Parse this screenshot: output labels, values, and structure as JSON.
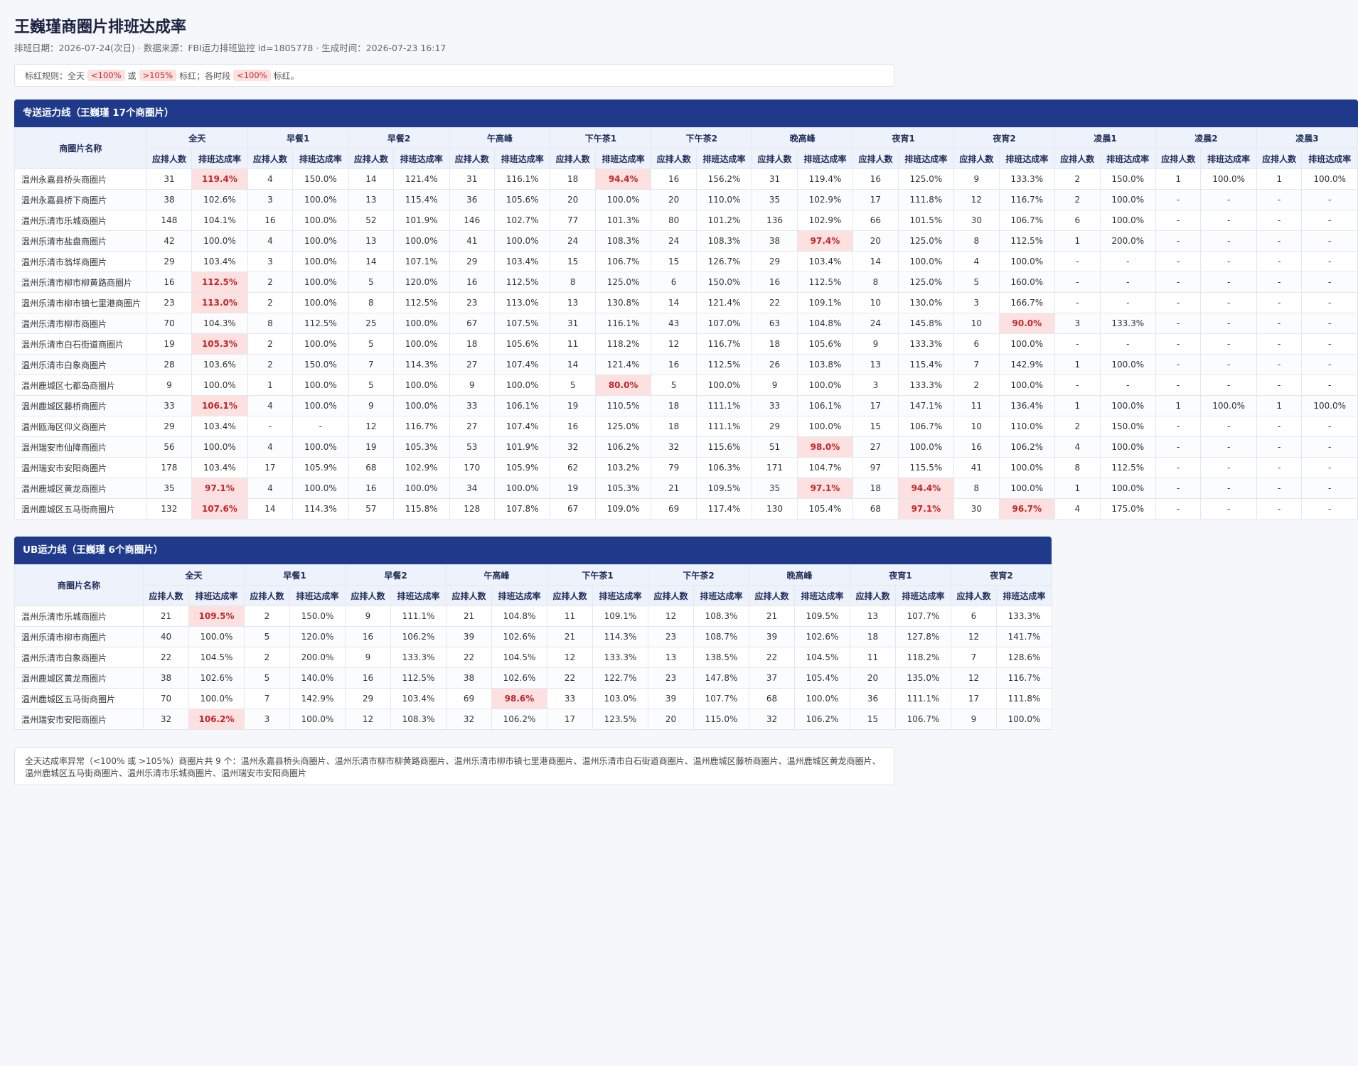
{
  "title": "王巍瑾商圈片排班达成率",
  "subtitle": "排班日期：2026-07-24(次日) · 数据来源：FBI运力排班监控 id=1805778 · 生成时间：2026-07-23 16:17",
  "rules": {
    "prefix": "标红规则：全天",
    "chip1": "<100%",
    "or": "或",
    "chip2": ">105%",
    "mid": "标红；各时段",
    "chip3": "<100%",
    "suffix": "标红。"
  },
  "colors": {
    "header_bar": "#1f3a8a",
    "alert_bg": "#fde1e1",
    "alert_text": "#c0262b"
  },
  "table1": {
    "title": "专送运力线（王巍瑾 17个商圈片）",
    "name_header": "商圈片名称",
    "sub_headers": [
      "应排人数",
      "排班达成率"
    ],
    "periods": [
      "全天",
      "早餐1",
      "早餐2",
      "午高峰",
      "下午茶1",
      "下午茶2",
      "晚高峰",
      "夜宵1",
      "夜宵2",
      "凌晨1",
      "凌晨2",
      "凌晨3"
    ],
    "rows": [
      {
        "name": "温州永嘉县桥头商圈片",
        "cells": [
          [
            "31",
            "119.4%"
          ],
          [
            "4",
            "150.0%"
          ],
          [
            "14",
            "121.4%"
          ],
          [
            "31",
            "116.1%"
          ],
          [
            "18",
            "94.4%"
          ],
          [
            "16",
            "156.2%"
          ],
          [
            "31",
            "119.4%"
          ],
          [
            "16",
            "125.0%"
          ],
          [
            "9",
            "133.3%"
          ],
          [
            "2",
            "150.0%"
          ],
          [
            "1",
            "100.0%"
          ],
          [
            "1",
            "100.0%"
          ]
        ]
      },
      {
        "name": "温州永嘉县桥下商圈片",
        "cells": [
          [
            "38",
            "102.6%"
          ],
          [
            "3",
            "100.0%"
          ],
          [
            "13",
            "115.4%"
          ],
          [
            "36",
            "105.6%"
          ],
          [
            "20",
            "100.0%"
          ],
          [
            "20",
            "110.0%"
          ],
          [
            "35",
            "102.9%"
          ],
          [
            "17",
            "111.8%"
          ],
          [
            "12",
            "116.7%"
          ],
          [
            "2",
            "100.0%"
          ],
          [
            "-",
            "-"
          ],
          [
            "-",
            "-"
          ]
        ]
      },
      {
        "name": "温州乐清市乐城商圈片",
        "cells": [
          [
            "148",
            "104.1%"
          ],
          [
            "16",
            "100.0%"
          ],
          [
            "52",
            "101.9%"
          ],
          [
            "146",
            "102.7%"
          ],
          [
            "77",
            "101.3%"
          ],
          [
            "80",
            "101.2%"
          ],
          [
            "136",
            "102.9%"
          ],
          [
            "66",
            "101.5%"
          ],
          [
            "30",
            "106.7%"
          ],
          [
            "6",
            "100.0%"
          ],
          [
            "-",
            "-"
          ],
          [
            "-",
            "-"
          ]
        ]
      },
      {
        "name": "温州乐清市盐盘商圈片",
        "cells": [
          [
            "42",
            "100.0%"
          ],
          [
            "4",
            "100.0%"
          ],
          [
            "13",
            "100.0%"
          ],
          [
            "41",
            "100.0%"
          ],
          [
            "24",
            "108.3%"
          ],
          [
            "24",
            "108.3%"
          ],
          [
            "38",
            "97.4%"
          ],
          [
            "20",
            "125.0%"
          ],
          [
            "8",
            "112.5%"
          ],
          [
            "1",
            "200.0%"
          ],
          [
            "-",
            "-"
          ],
          [
            "-",
            "-"
          ]
        ]
      },
      {
        "name": "温州乐清市翁垟商圈片",
        "cells": [
          [
            "29",
            "103.4%"
          ],
          [
            "3",
            "100.0%"
          ],
          [
            "14",
            "107.1%"
          ],
          [
            "29",
            "103.4%"
          ],
          [
            "15",
            "106.7%"
          ],
          [
            "15",
            "126.7%"
          ],
          [
            "29",
            "103.4%"
          ],
          [
            "14",
            "100.0%"
          ],
          [
            "4",
            "100.0%"
          ],
          [
            "-",
            "-"
          ],
          [
            "-",
            "-"
          ],
          [
            "-",
            "-"
          ]
        ]
      },
      {
        "name": "温州乐清市柳市柳黄路商圈片",
        "cells": [
          [
            "16",
            "112.5%"
          ],
          [
            "2",
            "100.0%"
          ],
          [
            "5",
            "120.0%"
          ],
          [
            "16",
            "112.5%"
          ],
          [
            "8",
            "125.0%"
          ],
          [
            "6",
            "150.0%"
          ],
          [
            "16",
            "112.5%"
          ],
          [
            "8",
            "125.0%"
          ],
          [
            "5",
            "160.0%"
          ],
          [
            "-",
            "-"
          ],
          [
            "-",
            "-"
          ],
          [
            "-",
            "-"
          ]
        ]
      },
      {
        "name": "温州乐清市柳市镇七里港商圈片",
        "cells": [
          [
            "23",
            "113.0%"
          ],
          [
            "2",
            "100.0%"
          ],
          [
            "8",
            "112.5%"
          ],
          [
            "23",
            "113.0%"
          ],
          [
            "13",
            "130.8%"
          ],
          [
            "14",
            "121.4%"
          ],
          [
            "22",
            "109.1%"
          ],
          [
            "10",
            "130.0%"
          ],
          [
            "3",
            "166.7%"
          ],
          [
            "-",
            "-"
          ],
          [
            "-",
            "-"
          ],
          [
            "-",
            "-"
          ]
        ]
      },
      {
        "name": "温州乐清市柳市商圈片",
        "cells": [
          [
            "70",
            "104.3%"
          ],
          [
            "8",
            "112.5%"
          ],
          [
            "25",
            "100.0%"
          ],
          [
            "67",
            "107.5%"
          ],
          [
            "31",
            "116.1%"
          ],
          [
            "43",
            "107.0%"
          ],
          [
            "63",
            "104.8%"
          ],
          [
            "24",
            "145.8%"
          ],
          [
            "10",
            "90.0%"
          ],
          [
            "3",
            "133.3%"
          ],
          [
            "-",
            "-"
          ],
          [
            "-",
            "-"
          ]
        ]
      },
      {
        "name": "温州乐清市白石街道商圈片",
        "cells": [
          [
            "19",
            "105.3%"
          ],
          [
            "2",
            "100.0%"
          ],
          [
            "5",
            "100.0%"
          ],
          [
            "18",
            "105.6%"
          ],
          [
            "11",
            "118.2%"
          ],
          [
            "12",
            "116.7%"
          ],
          [
            "18",
            "105.6%"
          ],
          [
            "9",
            "133.3%"
          ],
          [
            "6",
            "100.0%"
          ],
          [
            "-",
            "-"
          ],
          [
            "-",
            "-"
          ],
          [
            "-",
            "-"
          ]
        ]
      },
      {
        "name": "温州乐清市白象商圈片",
        "cells": [
          [
            "28",
            "103.6%"
          ],
          [
            "2",
            "150.0%"
          ],
          [
            "7",
            "114.3%"
          ],
          [
            "27",
            "107.4%"
          ],
          [
            "14",
            "121.4%"
          ],
          [
            "16",
            "112.5%"
          ],
          [
            "26",
            "103.8%"
          ],
          [
            "13",
            "115.4%"
          ],
          [
            "7",
            "142.9%"
          ],
          [
            "1",
            "100.0%"
          ],
          [
            "-",
            "-"
          ],
          [
            "-",
            "-"
          ]
        ]
      },
      {
        "name": "温州鹿城区七都岛商圈片",
        "cells": [
          [
            "9",
            "100.0%"
          ],
          [
            "1",
            "100.0%"
          ],
          [
            "5",
            "100.0%"
          ],
          [
            "9",
            "100.0%"
          ],
          [
            "5",
            "80.0%"
          ],
          [
            "5",
            "100.0%"
          ],
          [
            "9",
            "100.0%"
          ],
          [
            "3",
            "133.3%"
          ],
          [
            "2",
            "100.0%"
          ],
          [
            "-",
            "-"
          ],
          [
            "-",
            "-"
          ],
          [
            "-",
            "-"
          ]
        ]
      },
      {
        "name": "温州鹿城区藤桥商圈片",
        "cells": [
          [
            "33",
            "106.1%"
          ],
          [
            "4",
            "100.0%"
          ],
          [
            "9",
            "100.0%"
          ],
          [
            "33",
            "106.1%"
          ],
          [
            "19",
            "110.5%"
          ],
          [
            "18",
            "111.1%"
          ],
          [
            "33",
            "106.1%"
          ],
          [
            "17",
            "147.1%"
          ],
          [
            "11",
            "136.4%"
          ],
          [
            "1",
            "100.0%"
          ],
          [
            "1",
            "100.0%"
          ],
          [
            "1",
            "100.0%"
          ]
        ]
      },
      {
        "name": "温州瓯海区仰义商圈片",
        "cells": [
          [
            "29",
            "103.4%"
          ],
          [
            "-",
            "-"
          ],
          [
            "12",
            "116.7%"
          ],
          [
            "27",
            "107.4%"
          ],
          [
            "16",
            "125.0%"
          ],
          [
            "18",
            "111.1%"
          ],
          [
            "29",
            "100.0%"
          ],
          [
            "15",
            "106.7%"
          ],
          [
            "10",
            "110.0%"
          ],
          [
            "2",
            "150.0%"
          ],
          [
            "-",
            "-"
          ],
          [
            "-",
            "-"
          ]
        ]
      },
      {
        "name": "温州瑞安市仙降商圈片",
        "cells": [
          [
            "56",
            "100.0%"
          ],
          [
            "4",
            "100.0%"
          ],
          [
            "19",
            "105.3%"
          ],
          [
            "53",
            "101.9%"
          ],
          [
            "32",
            "106.2%"
          ],
          [
            "32",
            "115.6%"
          ],
          [
            "51",
            "98.0%"
          ],
          [
            "27",
            "100.0%"
          ],
          [
            "16",
            "106.2%"
          ],
          [
            "4",
            "100.0%"
          ],
          [
            "-",
            "-"
          ],
          [
            "-",
            "-"
          ]
        ]
      },
      {
        "name": "温州瑞安市安阳商圈片",
        "cells": [
          [
            "178",
            "103.4%"
          ],
          [
            "17",
            "105.9%"
          ],
          [
            "68",
            "102.9%"
          ],
          [
            "170",
            "105.9%"
          ],
          [
            "62",
            "103.2%"
          ],
          [
            "79",
            "106.3%"
          ],
          [
            "171",
            "104.7%"
          ],
          [
            "97",
            "115.5%"
          ],
          [
            "41",
            "100.0%"
          ],
          [
            "8",
            "112.5%"
          ],
          [
            "-",
            "-"
          ],
          [
            "-",
            "-"
          ]
        ]
      },
      {
        "name": "温州鹿城区黄龙商圈片",
        "cells": [
          [
            "35",
            "97.1%"
          ],
          [
            "4",
            "100.0%"
          ],
          [
            "16",
            "100.0%"
          ],
          [
            "34",
            "100.0%"
          ],
          [
            "19",
            "105.3%"
          ],
          [
            "21",
            "109.5%"
          ],
          [
            "35",
            "97.1%"
          ],
          [
            "18",
            "94.4%"
          ],
          [
            "8",
            "100.0%"
          ],
          [
            "1",
            "100.0%"
          ],
          [
            "-",
            "-"
          ],
          [
            "-",
            "-"
          ]
        ]
      },
      {
        "name": "温州鹿城区五马街商圈片",
        "cells": [
          [
            "132",
            "107.6%"
          ],
          [
            "14",
            "114.3%"
          ],
          [
            "57",
            "115.8%"
          ],
          [
            "128",
            "107.8%"
          ],
          [
            "67",
            "109.0%"
          ],
          [
            "69",
            "117.4%"
          ],
          [
            "130",
            "105.4%"
          ],
          [
            "68",
            "97.1%"
          ],
          [
            "30",
            "96.7%"
          ],
          [
            "4",
            "175.0%"
          ],
          [
            "-",
            "-"
          ],
          [
            "-",
            "-"
          ]
        ]
      }
    ]
  },
  "table2": {
    "title": "UB运力线（王巍瑾 6个商圈片）",
    "name_header": "商圈片名称",
    "sub_headers": [
      "应排人数",
      "排班达成率"
    ],
    "periods": [
      "全天",
      "早餐1",
      "早餐2",
      "午高峰",
      "下午茶1",
      "下午茶2",
      "晚高峰",
      "夜宵1",
      "夜宵2"
    ],
    "rows": [
      {
        "name": "温州乐清市乐城商圈片",
        "cells": [
          [
            "21",
            "109.5%"
          ],
          [
            "2",
            "150.0%"
          ],
          [
            "9",
            "111.1%"
          ],
          [
            "21",
            "104.8%"
          ],
          [
            "11",
            "109.1%"
          ],
          [
            "12",
            "108.3%"
          ],
          [
            "21",
            "109.5%"
          ],
          [
            "13",
            "107.7%"
          ],
          [
            "6",
            "133.3%"
          ]
        ]
      },
      {
        "name": "温州乐清市柳市商圈片",
        "cells": [
          [
            "40",
            "100.0%"
          ],
          [
            "5",
            "120.0%"
          ],
          [
            "16",
            "106.2%"
          ],
          [
            "39",
            "102.6%"
          ],
          [
            "21",
            "114.3%"
          ],
          [
            "23",
            "108.7%"
          ],
          [
            "39",
            "102.6%"
          ],
          [
            "18",
            "127.8%"
          ],
          [
            "12",
            "141.7%"
          ]
        ]
      },
      {
        "name": "温州乐清市白象商圈片",
        "cells": [
          [
            "22",
            "104.5%"
          ],
          [
            "2",
            "200.0%"
          ],
          [
            "9",
            "133.3%"
          ],
          [
            "22",
            "104.5%"
          ],
          [
            "12",
            "133.3%"
          ],
          [
            "13",
            "138.5%"
          ],
          [
            "22",
            "104.5%"
          ],
          [
            "11",
            "118.2%"
          ],
          [
            "7",
            "128.6%"
          ]
        ]
      },
      {
        "name": "温州鹿城区黄龙商圈片",
        "cells": [
          [
            "38",
            "102.6%"
          ],
          [
            "5",
            "140.0%"
          ],
          [
            "16",
            "112.5%"
          ],
          [
            "38",
            "102.6%"
          ],
          [
            "22",
            "122.7%"
          ],
          [
            "23",
            "147.8%"
          ],
          [
            "37",
            "105.4%"
          ],
          [
            "20",
            "135.0%"
          ],
          [
            "12",
            "116.7%"
          ]
        ]
      },
      {
        "name": "温州鹿城区五马街商圈片",
        "cells": [
          [
            "70",
            "100.0%"
          ],
          [
            "7",
            "142.9%"
          ],
          [
            "29",
            "103.4%"
          ],
          [
            "69",
            "98.6%"
          ],
          [
            "33",
            "103.0%"
          ],
          [
            "39",
            "107.7%"
          ],
          [
            "68",
            "100.0%"
          ],
          [
            "36",
            "111.1%"
          ],
          [
            "17",
            "111.8%"
          ]
        ]
      },
      {
        "name": "温州瑞安市安阳商圈片",
        "cells": [
          [
            "32",
            "106.2%"
          ],
          [
            "3",
            "100.0%"
          ],
          [
            "12",
            "108.3%"
          ],
          [
            "32",
            "106.2%"
          ],
          [
            "17",
            "123.5%"
          ],
          [
            "20",
            "115.0%"
          ],
          [
            "32",
            "106.2%"
          ],
          [
            "15",
            "106.7%"
          ],
          [
            "9",
            "100.0%"
          ]
        ]
      }
    ]
  },
  "summary": "全天达成率异常（<100% 或 >105%）商圈片共 9 个：温州永嘉县桥头商圈片、温州乐清市柳市柳黄路商圈片、温州乐清市柳市镇七里港商圈片、温州乐清市白石街道商圈片、温州鹿城区藤桥商圈片、温州鹿城区黄龙商圈片、温州鹿城区五马街商圈片、温州乐清市乐城商圈片、温州瑞安市安阳商圈片"
}
